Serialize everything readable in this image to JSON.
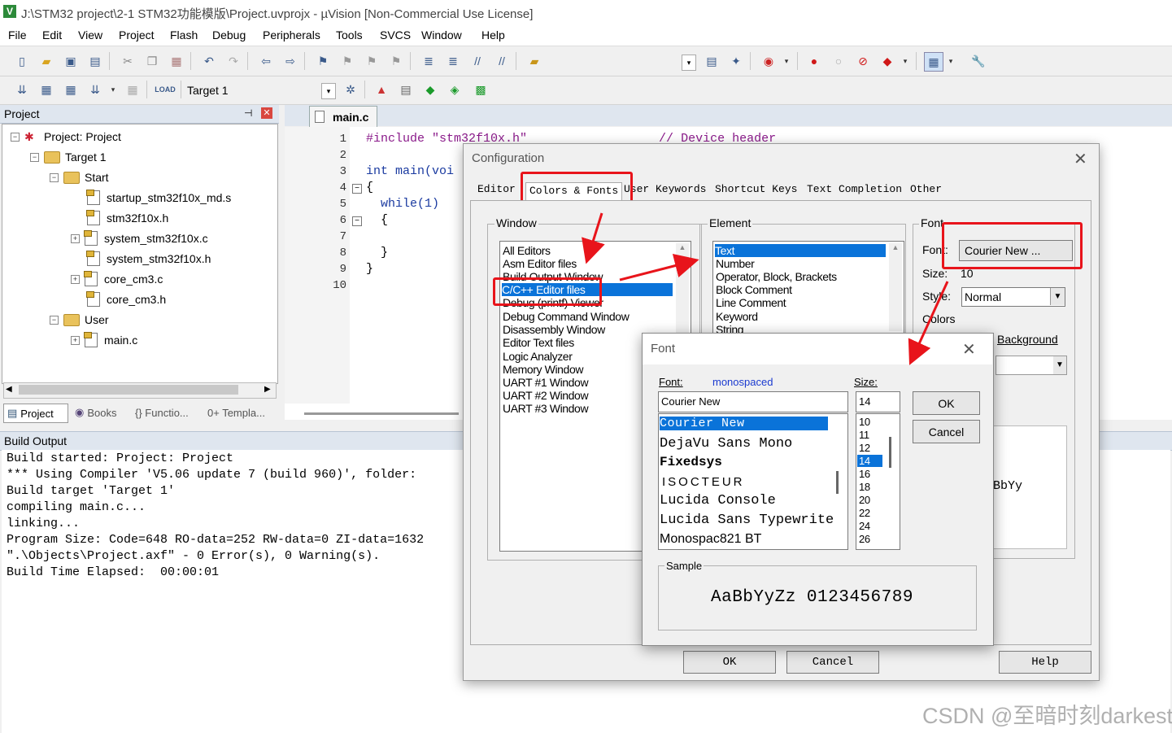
{
  "window": {
    "title": "J:\\STM32 project\\2-1 STM32功能模版\\Project.uvprojx - µVision  [Non-Commercial Use License]",
    "app_icon": "V"
  },
  "menu": [
    "File",
    "Edit",
    "View",
    "Project",
    "Flash",
    "Debug",
    "Peripherals",
    "Tools",
    "SVCS",
    "Window",
    "Help"
  ],
  "toolbar2": {
    "target": "Target 1"
  },
  "project_panel": {
    "title": "Project",
    "tree": [
      {
        "label": "Project: Project",
        "level": 0
      },
      {
        "label": "Target 1",
        "level": 1
      },
      {
        "label": "Start",
        "level": 2
      },
      {
        "label": "startup_stm32f10x_md.s",
        "level": 3
      },
      {
        "label": "stm32f10x.h",
        "level": 3
      },
      {
        "label": "system_stm32f10x.c",
        "level": 3
      },
      {
        "label": "system_stm32f10x.h",
        "level": 3
      },
      {
        "label": "core_cm3.c",
        "level": 3
      },
      {
        "label": "core_cm3.h",
        "level": 3
      },
      {
        "label": "User",
        "level": 2
      },
      {
        "label": "main.c",
        "level": 3
      }
    ],
    "tabs": [
      "Project",
      "Books",
      "{} Functio...",
      "0+ Templa..."
    ]
  },
  "editor": {
    "tab": "main.c",
    "lines": [
      {
        "n": "1",
        "code": "#include \"stm32f10x.h\"                  // Device header"
      },
      {
        "n": "2",
        "code": ""
      },
      {
        "n": "3",
        "code": "int main(voi"
      },
      {
        "n": "4",
        "code": "{"
      },
      {
        "n": "5",
        "code": "  while(1)"
      },
      {
        "n": "6",
        "code": "  {"
      },
      {
        "n": "7",
        "code": ""
      },
      {
        "n": "8",
        "code": "  }"
      },
      {
        "n": "9",
        "code": "}"
      },
      {
        "n": "10",
        "code": ""
      }
    ]
  },
  "build_output": {
    "title": "Build Output",
    "lines": [
      "Build started: Project: Project",
      "*** Using Compiler 'V5.06 update 7 (build 960)', folder:",
      "Build target 'Target 1'",
      "compiling main.c...",
      "linking...",
      "Program Size: Code=648 RO-data=252 RW-data=0 ZI-data=1632",
      "\".\\Objects\\Project.axf\" - 0 Error(s), 0 Warning(s).",
      "Build Time Elapsed:  00:00:01"
    ]
  },
  "config_dialog": {
    "title": "Configuration",
    "tabs": [
      "Editor",
      "Colors & Fonts",
      "User Keywords",
      "Shortcut Keys",
      "Text Completion",
      "Other"
    ],
    "window_group": "Window",
    "window_items": [
      "All Editors",
      "Asm Editor files",
      "Build Output Window",
      "C/C++ Editor files",
      "Debug (printf) Viewer",
      "Debug Command Window",
      "Disassembly Window",
      "Editor Text files",
      "Logic Analyzer",
      "Memory Window",
      "UART #1 Window",
      "UART #2 Window",
      "UART #3 Window"
    ],
    "selected_window": "C/C++ Editor files",
    "element_group": "Element",
    "element_items": [
      "Text",
      "Number",
      "Operator, Block, Brackets",
      "Block Comment",
      "Line Comment",
      "Keyword",
      "String"
    ],
    "selected_element": "Text",
    "font_group": "Font",
    "font_label": "Font:",
    "font_button": "Courier New ...",
    "size_label": "Size:",
    "size_value": "10",
    "style_label": "Style:",
    "style_value": "Normal",
    "colors_label": "Colors",
    "background_label": "Background",
    "sample_fragment": "BbYy",
    "ok": "OK",
    "cancel": "Cancel",
    "help": "Help"
  },
  "font_dialog": {
    "title": "Font",
    "font_label": "Font:",
    "font_hint": "monospaced",
    "font_value": "Courier New",
    "fonts": [
      "Courier New",
      "DejaVu Sans Mono",
      "Fixedsys",
      "ISOCTEUR",
      "Lucida Console",
      "Lucida Sans Typewrite",
      "Monospac821 BT"
    ],
    "size_label": "Size:",
    "size_value": "14",
    "sizes": [
      "10",
      "11",
      "12",
      "14",
      "16",
      "18",
      "20",
      "22",
      "24",
      "26"
    ],
    "ok": "OK",
    "cancel": "Cancel",
    "sample_label": "Sample",
    "sample_text": "AaBbYyZz 0123456789"
  },
  "watermark": "CSDN @至暗时刻darkest",
  "colors": {
    "selection": "#0a73d9",
    "highlight_box": "#e8141b",
    "keyword": "#1a3aa0",
    "comment": "#2a8a2a",
    "string": "#8a1a8a"
  }
}
